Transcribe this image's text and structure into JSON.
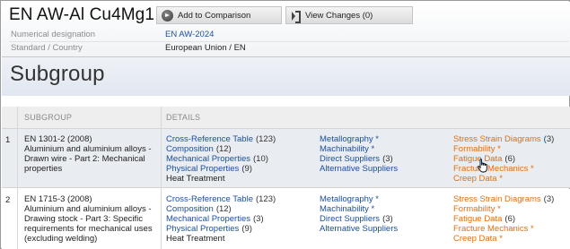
{
  "material": {
    "title": "EN AW-Al Cu4Mg1",
    "meta": [
      {
        "label": "Numerical designation",
        "value": "EN AW-2024"
      },
      {
        "label": "Standard / Country",
        "value": "European Union / EN"
      }
    ]
  },
  "toolbar": {
    "add_label": "Add to Comparison",
    "view_label": "View Changes (0)",
    "add_icon": "play-circle-icon",
    "view_icon": "view-changes-icon"
  },
  "section": {
    "title": "Subgroup"
  },
  "table": {
    "headers": {
      "subgroup": "SUBGROUP",
      "details": "DETAILS"
    },
    "rows": [
      {
        "num": "1",
        "subgroup": "EN 1301-2  (2008)\nAluminium and aluminium alloys - Drawn wire - Part 2: Mechanical properties",
        "col1": [
          {
            "text": "Cross-Reference Table",
            "count": "(123)"
          },
          {
            "text": "Composition",
            "count": "(12)"
          },
          {
            "text": "Mechanical Properties",
            "count": "(10)"
          },
          {
            "text": "Physical Properties",
            "count": "(9)"
          },
          {
            "text": "Heat Treatment",
            "count": ""
          }
        ],
        "col2": [
          {
            "text": "Metallography *",
            "count": ""
          },
          {
            "text": "Machinability *",
            "count": ""
          },
          {
            "text": "Direct Suppliers",
            "count": "(3)"
          },
          {
            "text": "Alternative Suppliers",
            "count": ""
          }
        ],
        "col3": [
          {
            "text": "Stress Strain Diagrams",
            "count": "(3)"
          },
          {
            "text": "Formability *",
            "count": ""
          },
          {
            "text": "Fatigue Data",
            "count": "(6)"
          },
          {
            "text": "Fracture Mechanics *",
            "count": ""
          },
          {
            "text": "Creep Data *",
            "count": ""
          }
        ]
      },
      {
        "num": "2",
        "subgroup": "EN 1715-3  (2008)\nAluminium and aluminium alloys - Drawing stock - Part 3: Specific requirements for mechanical uses (excluding welding)",
        "col1": [
          {
            "text": "Cross-Reference Table",
            "count": "(123)"
          },
          {
            "text": "Composition",
            "count": "(12)"
          },
          {
            "text": "Mechanical Properties",
            "count": "(3)"
          },
          {
            "text": "Physical Properties",
            "count": "(9)"
          },
          {
            "text": "Heat Treatment",
            "count": ""
          }
        ],
        "col2": [
          {
            "text": "Metallography *",
            "count": ""
          },
          {
            "text": "Machinability *",
            "count": ""
          },
          {
            "text": "Direct Suppliers",
            "count": "(3)"
          },
          {
            "text": "Alternative Suppliers",
            "count": ""
          }
        ],
        "col3": [
          {
            "text": "Stress Strain Diagrams",
            "count": "(3)"
          },
          {
            "text": "Formability *",
            "count": ""
          },
          {
            "text": "Fatigue Data",
            "count": "(6)"
          },
          {
            "text": "Fracture Mechanics *",
            "count": ""
          },
          {
            "text": "Creep Data *",
            "count": ""
          }
        ]
      }
    ]
  },
  "colors": {
    "link": "#1a4f9c",
    "link_orange": "#e0700f",
    "band": "#e1e7f1"
  }
}
